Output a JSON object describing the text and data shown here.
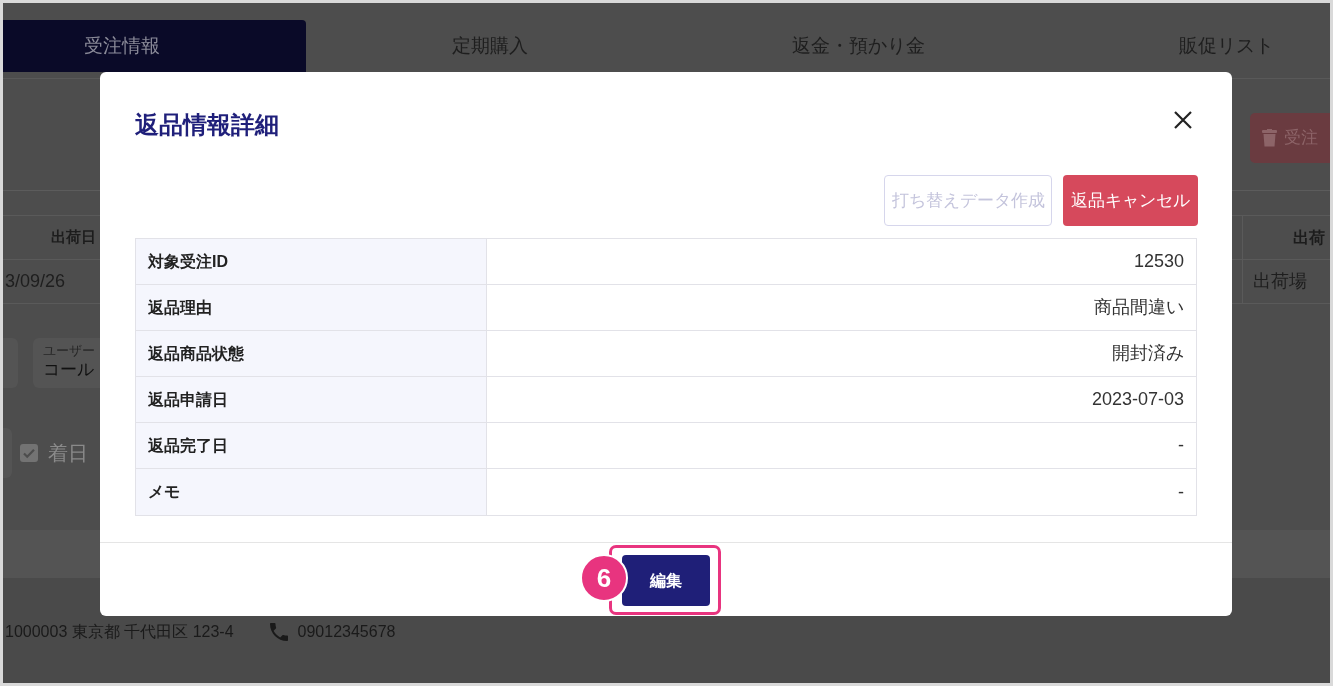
{
  "background": {
    "tabs": [
      {
        "label": "受注情報",
        "selected": true
      },
      {
        "label": "定期購入",
        "selected": false
      },
      {
        "label": "返金・預かり金",
        "selected": false
      },
      {
        "label": "販促リスト",
        "selected": false
      }
    ],
    "action_button": {
      "label": "受注"
    },
    "table": {
      "columns": [
        "出荷日",
        "出荷"
      ],
      "rows": [
        [
          "3/09/26",
          "出荷場"
        ]
      ]
    },
    "user_field": {
      "label": "ユーザー",
      "value": "コール"
    },
    "checkbox": {
      "label": "着日",
      "checked": true
    },
    "address": "1000003 東京都 千代田区 123-4",
    "phone": "09012345678"
  },
  "modal": {
    "title": "返品情報詳細",
    "actions": [
      {
        "label": "打ち替えデータ作成",
        "kind": "outline",
        "disabled": true
      },
      {
        "label": "返品キャンセル",
        "kind": "danger",
        "disabled": false
      }
    ],
    "details": [
      {
        "label": "対象受注ID",
        "value": "12530"
      },
      {
        "label": "返品理由",
        "value": "商品間違い"
      },
      {
        "label": "返品商品状態",
        "value": "開封済み"
      },
      {
        "label": "返品申請日",
        "value": "2023-07-03"
      },
      {
        "label": "返品完了日",
        "value": "-"
      },
      {
        "label": "メモ",
        "value": "-"
      }
    ],
    "footer_button": {
      "label": "編集"
    },
    "annotation": {
      "step": "6"
    }
  }
}
